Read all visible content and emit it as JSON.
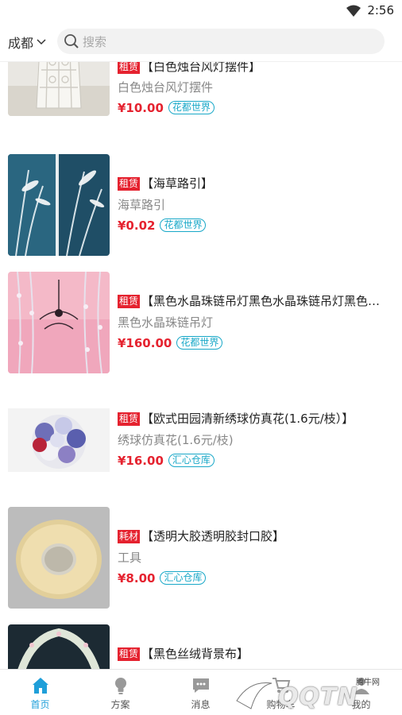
{
  "status_bar": {
    "time": "2:56"
  },
  "header": {
    "city": "成都",
    "search_placeholder": "搜索"
  },
  "products": [
    {
      "tag": "租赁",
      "title": "【白色烛台风灯摆件】",
      "subtitle": "白色烛台风灯摆件",
      "price": "¥10.00",
      "shop": "花都世界",
      "image": "white-lantern"
    },
    {
      "tag": "租赁",
      "title": "【海草路引】",
      "subtitle": "海草路引",
      "price": "¥0.02",
      "shop": "花都世界",
      "image": "seagrass-road-guide"
    },
    {
      "tag": "租赁",
      "title": "【黑色水晶珠链吊灯黑色水晶珠链吊灯黑色…",
      "subtitle": "黑色水晶珠链吊灯",
      "price": "¥160.00",
      "shop": "花都世界",
      "image": "crystal-chandelier"
    },
    {
      "tag": "租赁",
      "title": "【欧式田园清新绣球仿真花(1.6元/枝）】",
      "subtitle": "绣球仿真花(1.6元/枝)",
      "price": "¥16.00",
      "shop": "汇心仓库",
      "image": "hydrangea-ball"
    },
    {
      "tag": "耗材",
      "title": "【透明大胶透明胶封口胶】",
      "subtitle": "工具",
      "price": "¥8.00",
      "shop": "汇心仓库",
      "image": "packing-tape"
    },
    {
      "tag": "租赁",
      "title": "【黑色丝绒背景布】",
      "subtitle": "",
      "price": "",
      "shop": "",
      "image": "velvet-backdrop"
    }
  ],
  "tab_bar": {
    "tabs": [
      {
        "label": "首页",
        "icon": "home-icon",
        "active": true
      },
      {
        "label": "方案",
        "icon": "lightbulb-icon",
        "active": false
      },
      {
        "label": "消息",
        "icon": "message-icon",
        "active": false
      },
      {
        "label": "购物车",
        "icon": "cart-icon",
        "active": false
      },
      {
        "label": "我的",
        "icon": "profile-icon",
        "active": false
      }
    ]
  },
  "watermark": {
    "text": "QQTN",
    "small": "腾牛网"
  },
  "colors": {
    "accent": "#1f9fd9",
    "price_red": "#e5222f",
    "shop_teal": "#19a8c8"
  }
}
